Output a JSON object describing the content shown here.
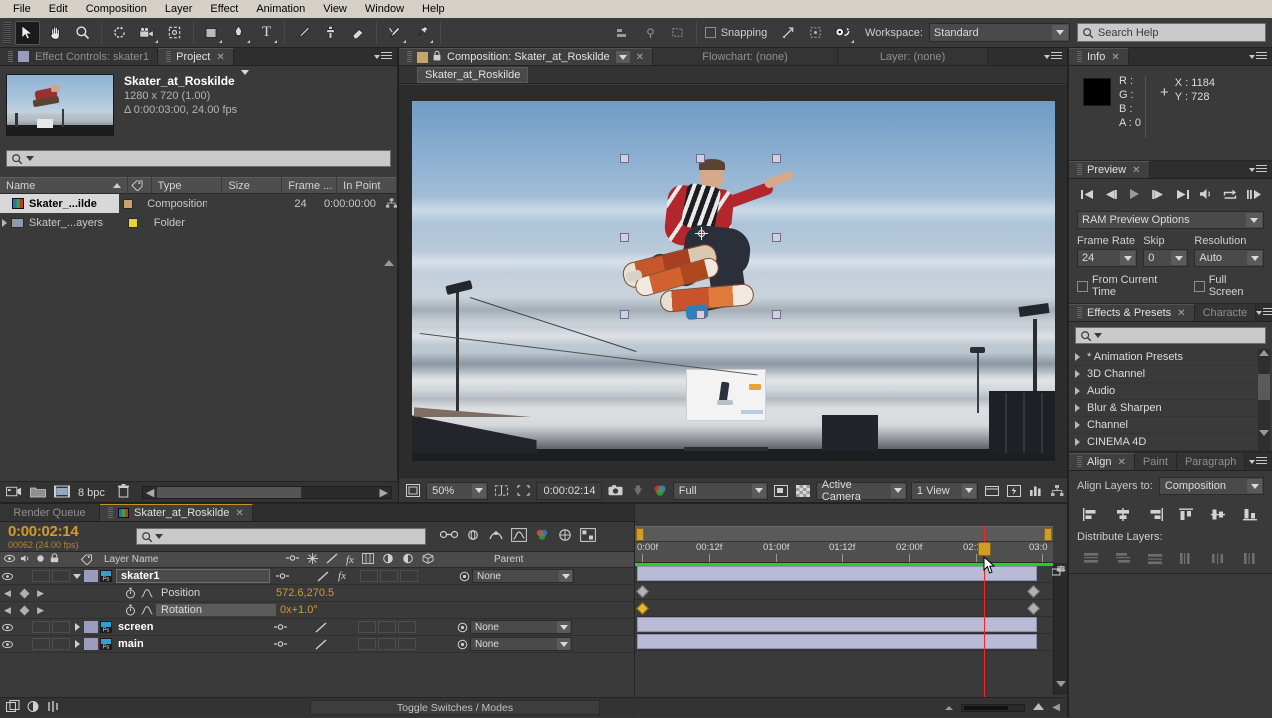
{
  "app": {
    "name": "Adobe After Effects"
  },
  "menubar": {
    "items": [
      "File",
      "Edit",
      "Composition",
      "Layer",
      "Effect",
      "Animation",
      "View",
      "Window",
      "Help"
    ]
  },
  "toolbar": {
    "tools": [
      {
        "name": "selection-tool",
        "glyph": "↖",
        "active": true
      },
      {
        "name": "hand-tool",
        "glyph": "✋",
        "active": false
      },
      {
        "name": "zoom-tool",
        "glyph": "⚲",
        "active": false
      },
      {
        "name": "rotation-tool",
        "glyph": "↻",
        "active": false
      },
      {
        "name": "camera-tool",
        "glyph": "🎥",
        "active": false
      },
      {
        "name": "pan-behind-tool",
        "glyph": "❈",
        "active": false
      },
      {
        "name": "shape-tool",
        "glyph": "■",
        "active": false
      },
      {
        "name": "pen-tool",
        "glyph": "✒",
        "active": false
      },
      {
        "name": "type-tool",
        "glyph": "T",
        "active": false
      },
      {
        "name": "brush-tool",
        "glyph": "╱",
        "active": false
      },
      {
        "name": "clone-stamp-tool",
        "glyph": "⚑",
        "active": false
      },
      {
        "name": "eraser-tool",
        "glyph": "▱",
        "active": false
      },
      {
        "name": "roto-brush-tool",
        "glyph": "✐",
        "active": false
      },
      {
        "name": "puppet-pin-tool",
        "glyph": "☂",
        "active": false
      }
    ],
    "snapping_label": "Snapping",
    "snapping_checked": false,
    "workspace_label": "Workspace:",
    "workspace_value": "Standard",
    "search_help_placeholder": "Search Help"
  },
  "project_panel": {
    "tabs": [
      {
        "label": "Effect Controls: skater1",
        "active": false
      },
      {
        "label": "Project",
        "active": true,
        "closable": true
      }
    ],
    "item_title": "Skater_at_Roskilde",
    "item_dimensions": "1280 x 720 (1.00)",
    "item_duration": "Δ 0:00:03:00, 24.00 fps",
    "search_placeholder": "",
    "columns": [
      "Name",
      "Type",
      "Size",
      "Frame ...",
      "In Point"
    ],
    "rows": [
      {
        "name": "Skater_...ilde",
        "type": "Composition",
        "size": "",
        "frame": "24",
        "in_point": "0:00:00:00",
        "selected": true,
        "swatch": "#c9a36b",
        "icon": "composition-icon"
      },
      {
        "name": "Skater_...ayers",
        "type": "Folder",
        "size": "",
        "frame": "",
        "in_point": "",
        "selected": false,
        "swatch": "#e3d23a",
        "icon": "folder-icon"
      }
    ],
    "bitdepth": "8 bpc"
  },
  "comp_panel": {
    "tabs": [
      {
        "label": "Composition: Skater_at_Roskilde",
        "active": true,
        "closable": true
      },
      {
        "label": "Flowchart: (none)",
        "active": false
      },
      {
        "label": "Layer: (none)",
        "active": false
      }
    ],
    "sub_tab": "Skater_at_Roskilde",
    "bottom_bar": {
      "magnification": "50%",
      "current_time": "0:00:02:14",
      "resolution": "Full",
      "camera_view": "Active Camera",
      "view_count": "1 View"
    }
  },
  "info_panel": {
    "tab": "Info",
    "r_label": "R :",
    "g_label": "G :",
    "b_label": "B :",
    "a_label": "A : 0",
    "x_label": "X : 1184",
    "y_label": "Y : 728",
    "swatch_color": "#000000"
  },
  "preview_panel": {
    "tab": "Preview",
    "transport": [
      "first-frame",
      "previous-frame",
      "play",
      "next-frame",
      "last-frame",
      "audio",
      "loop",
      "ram-preview"
    ],
    "ram_preview_options": "RAM Preview Options",
    "frame_rate_label": "Frame Rate",
    "frame_rate_value": "24",
    "skip_label": "Skip",
    "skip_value": "0",
    "resolution_label": "Resolution",
    "resolution_value": "Auto",
    "from_current_time_label": "From Current Time",
    "from_current_time_checked": false,
    "full_screen_label": "Full Screen",
    "full_screen_checked": false
  },
  "effects_panel": {
    "tabs": [
      {
        "label": "Effects & Presets",
        "active": true,
        "closable": true
      },
      {
        "label": "Characte",
        "active": false
      }
    ],
    "search_placeholder": "",
    "items": [
      "* Animation Presets",
      "3D Channel",
      "Audio",
      "Blur & Sharpen",
      "Channel",
      "CINEMA 4D"
    ]
  },
  "align_panel": {
    "tabs": [
      {
        "label": "Align",
        "active": true,
        "closable": true
      },
      {
        "label": "Paint",
        "active": false
      },
      {
        "label": "Paragraph",
        "active": false
      }
    ],
    "align_layers_to_label": "Align Layers to:",
    "align_layers_to_value": "Composition",
    "distribute_label": "Distribute Layers:"
  },
  "timeline": {
    "tabs": [
      {
        "label": "Render Queue",
        "active": false
      },
      {
        "label": "Skater_at_Roskilde",
        "active": true,
        "closable": true
      }
    ],
    "current_timecode": "0:00:02:14",
    "frame_readout": "00062 (24.00 fps)",
    "search_placeholder": "",
    "column_headers": {
      "layer_name": "Layer Name",
      "parent": "Parent"
    },
    "ruler_labels": [
      "0:00f",
      "00:12f",
      "01:00f",
      "01:12f",
      "02:00f",
      "02:12f",
      "03:0"
    ],
    "layers": [
      {
        "name": "skater1",
        "type": "layer",
        "indent": 0,
        "parent": "None",
        "expanded": true,
        "has_fx": true,
        "selected": true,
        "bar_start": 0,
        "bar_end": 400,
        "properties": [
          {
            "name": "Position",
            "value": "572.6,270.5",
            "keyframes": [
              {
                "pos": 0,
                "color": "gray"
              },
              {
                "pos": 400,
                "color": "gray"
              }
            ]
          },
          {
            "name": "Rotation",
            "value": "0x+1.0°",
            "keyframes": [
              {
                "pos": 0,
                "color": "yellow"
              },
              {
                "pos": 400,
                "color": "gray"
              }
            ]
          }
        ]
      },
      {
        "name": "screen",
        "type": "layer",
        "indent": 0,
        "parent": "None",
        "expanded": false,
        "has_fx": false,
        "selected": false,
        "bar_start": 0,
        "bar_end": 400,
        "properties": []
      },
      {
        "name": "main",
        "type": "layer",
        "indent": 0,
        "parent": "None",
        "expanded": false,
        "has_fx": false,
        "selected": false,
        "bar_start": 0,
        "bar_end": 400,
        "properties": []
      }
    ],
    "toggle_switches_modes": "Toggle Switches / Modes"
  }
}
